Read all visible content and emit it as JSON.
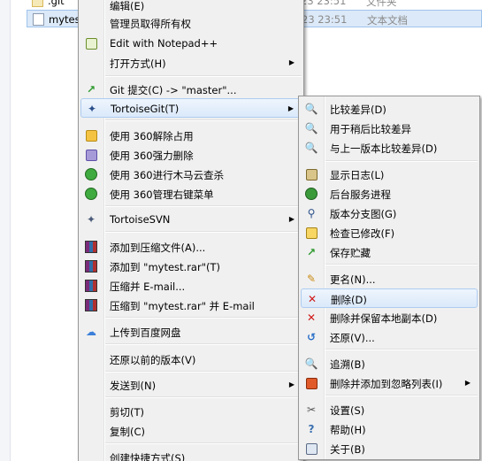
{
  "explorer": {
    "files": [
      {
        "name": ".git",
        "date": "23 23:51",
        "type": "文件夹"
      },
      {
        "name": "mytes",
        "date": "23 23:51",
        "type": "文本文档"
      }
    ]
  },
  "main_menu": {
    "items": [
      {
        "label": "编辑(E)",
        "icon": "none"
      },
      {
        "label": "管理员取得所有权",
        "icon": "none"
      },
      {
        "label": "Edit with Notepad++",
        "icon": "notepad-icon"
      },
      {
        "label": "打开方式(H)",
        "icon": "none",
        "submenu": true
      },
      {
        "label": "Git 提交(C) -> \"master\"...",
        "icon": "git-commit-icon"
      },
      {
        "label": "TortoiseGit(T)",
        "icon": "tortoisegit-icon",
        "submenu": true,
        "highlighted": true
      },
      {
        "label": "使用 360解除占用",
        "icon": "360-unlock-icon"
      },
      {
        "label": "使用 360强力删除",
        "icon": "360-shred-icon"
      },
      {
        "label": "使用 360进行木马云查杀",
        "icon": "360-scan-icon"
      },
      {
        "label": "使用 360管理右键菜单",
        "icon": "360-menu-icon"
      },
      {
        "label": "TortoiseSVN",
        "icon": "tortoisesvn-icon",
        "submenu": true
      },
      {
        "label": "添加到压缩文件(A)...",
        "icon": "winrar-icon"
      },
      {
        "label": "添加到 \"mytest.rar\"(T)",
        "icon": "winrar-icon"
      },
      {
        "label": "压缩并 E-mail...",
        "icon": "winrar-icon"
      },
      {
        "label": "压缩到 \"mytest.rar\" 并 E-mail",
        "icon": "winrar-icon"
      },
      {
        "label": "上传到百度网盘",
        "icon": "baidu-pan-icon"
      },
      {
        "label": "还原以前的版本(V)",
        "icon": "none"
      },
      {
        "label": "发送到(N)",
        "icon": "none",
        "submenu": true
      },
      {
        "label": "剪切(T)",
        "icon": "none"
      },
      {
        "label": "复制(C)",
        "icon": "none"
      },
      {
        "label": "创建快捷方式(S)",
        "icon": "none"
      }
    ]
  },
  "sub_menu": {
    "items": [
      {
        "label": "比较差异(D)",
        "icon": "diff-icon"
      },
      {
        "label": "用于稍后比较差异",
        "icon": "diff-later-icon"
      },
      {
        "label": "与上一版本比较差异(D)",
        "icon": "diff-previous-icon"
      },
      {
        "label": "显示日志(L)",
        "icon": "log-icon"
      },
      {
        "label": "后台服务进程",
        "icon": "daemon-icon"
      },
      {
        "label": "版本分支图(G)",
        "icon": "revision-graph-icon"
      },
      {
        "label": "检查已修改(F)",
        "icon": "check-modifications-icon"
      },
      {
        "label": "保存贮藏",
        "icon": "stash-icon"
      },
      {
        "label": "更名(N)...",
        "icon": "rename-icon"
      },
      {
        "label": "删除(D)",
        "icon": "delete-icon",
        "highlighted": true
      },
      {
        "label": "删除并保留本地副本(D)",
        "icon": "delete-keep-local-icon"
      },
      {
        "label": "还原(V)...",
        "icon": "revert-icon"
      },
      {
        "label": "追溯(B)",
        "icon": "blame-icon"
      },
      {
        "label": "删除并添加到忽略列表(I)",
        "icon": "ignore-icon",
        "submenu": true
      },
      {
        "label": "设置(S)",
        "icon": "settings-icon"
      },
      {
        "label": "帮助(H)",
        "icon": "help-icon"
      },
      {
        "label": "关于(B)",
        "icon": "about-icon"
      }
    ]
  },
  "submenu_arrow": "▶"
}
